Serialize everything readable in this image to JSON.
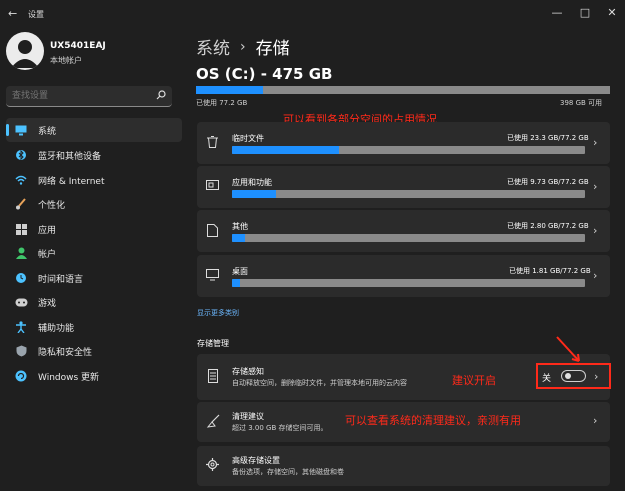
{
  "window": {
    "back_glyph": "←",
    "title": "设置",
    "min_glyph": "—",
    "max_glyph": "□",
    "close_glyph": "✕"
  },
  "user": {
    "name": "UX5401EAJ",
    "account": "本地帐户"
  },
  "search": {
    "placeholder": "查找设置"
  },
  "sidebar": {
    "items": [
      {
        "label": "系统",
        "icon": "monitor-icon"
      },
      {
        "label": "蓝牙和其他设备",
        "icon": "bluetooth-icon"
      },
      {
        "label": "网络 & Internet",
        "icon": "wifi-icon"
      },
      {
        "label": "个性化",
        "icon": "brush-icon"
      },
      {
        "label": "应用",
        "icon": "apps-icon"
      },
      {
        "label": "帐户",
        "icon": "person-icon"
      },
      {
        "label": "时间和语言",
        "icon": "globe-clock-icon"
      },
      {
        "label": "游戏",
        "icon": "gamepad-icon"
      },
      {
        "label": "辅助功能",
        "icon": "accessibility-icon"
      },
      {
        "label": "隐私和安全性",
        "icon": "shield-icon"
      },
      {
        "label": "Windows 更新",
        "icon": "update-icon"
      }
    ]
  },
  "breadcrumb": {
    "parent": "系统",
    "sep": "›",
    "current": "存储"
  },
  "drive": {
    "title": "OS (C:) - 475 GB",
    "used_label": "已使用 77.2 GB",
    "free_label": "398 GB 可用",
    "used_fraction": 0.162
  },
  "categories": [
    {
      "name": "临时文件",
      "usage": "已使用 23.3 GB/77.2 GB",
      "fraction": 0.302,
      "icon": "trash-icon"
    },
    {
      "name": "应用和功能",
      "usage": "已使用 9.73 GB/77.2 GB",
      "fraction": 0.126,
      "icon": "app-window-icon"
    },
    {
      "name": "其他",
      "usage": "已使用 2.80 GB/77.2 GB",
      "fraction": 0.036,
      "icon": "document-icon"
    },
    {
      "name": "桌面",
      "usage": "已使用 1.81 GB/77.2 GB",
      "fraction": 0.023,
      "icon": "desktop-icon"
    }
  ],
  "show_more": "显示更多类别",
  "management": {
    "heading": "存储管理"
  },
  "storage_sense": {
    "title": "存储感知",
    "desc": "自动释放空间，删除临时文件，并管理本地可用的云内容",
    "toggle_label": "关",
    "toggle_on": false
  },
  "cleanup": {
    "title": "清理建议",
    "desc": "超过 3.00 GB 存储空间可用。"
  },
  "advanced": {
    "title": "高级存储设置",
    "desc": "备份选项，存储空间，其他磁盘和卷"
  },
  "annotations": {
    "usage_note": "可以看到各部分空间的占用情况",
    "enable_note": "建议开启",
    "cleanup_note": "可以查看系统的清理建议，亲测有用"
  },
  "colors": {
    "accent": "#1e90ff",
    "annotation": "#ff2a1a"
  }
}
